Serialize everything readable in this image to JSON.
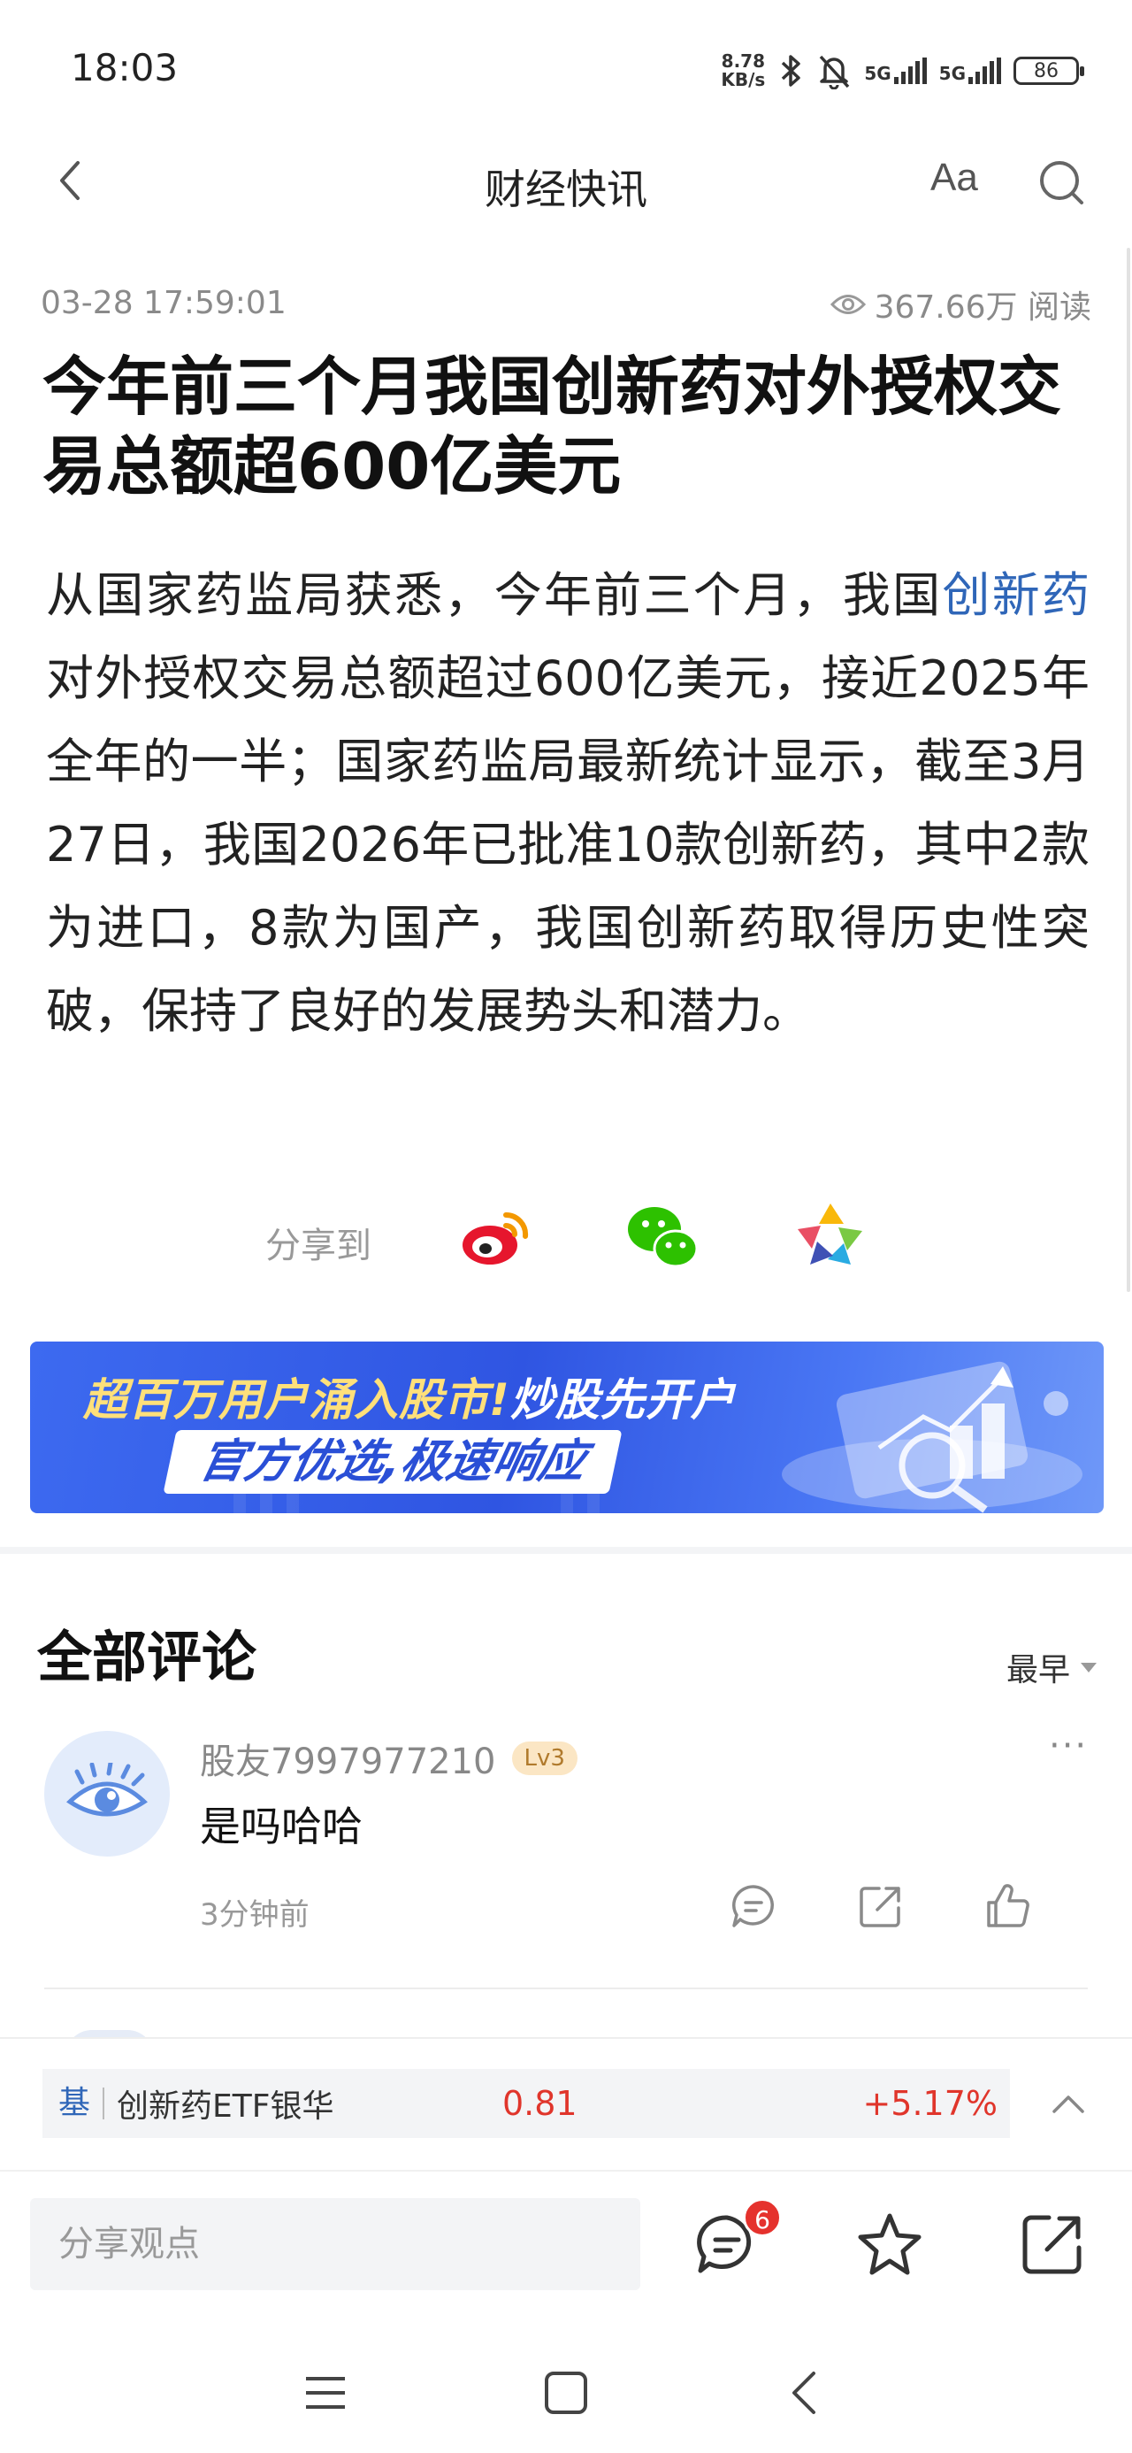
{
  "status_bar": {
    "time": "18:03",
    "net_speed_value": "8.78",
    "net_speed_unit": "KB/s",
    "signal1": "5G",
    "signal2": "5G",
    "battery": "86"
  },
  "nav": {
    "title": "财经快讯",
    "font_button": "Aa"
  },
  "article": {
    "timestamp": "03-28 17:59:01",
    "reads": "367.66万 阅读",
    "title": "今年前三个月我国创新药对外授权交易总额超600亿美元",
    "body_before_link": "从国家药监局获悉，今年前三个月，我国",
    "body_link": "创新药",
    "body_after_link": "对外授权交易总额超过600亿美元，接近2025年全年的一半；国家药监局最新统计显示，截至3月27日，我国2026年已批准10款创新药，其中2款为进口，8款为国产，我国创新药取得历史性突破，保持了良好的发展势头和潜力。"
  },
  "share": {
    "label": "分享到",
    "targets": [
      "weibo-icon",
      "wechat-icon",
      "moments-icon"
    ]
  },
  "banner": {
    "line1_a": "超百万用户涌入股市!",
    "line1_b": "炒股先开户",
    "line2": "官方优选,极速响应"
  },
  "comments": {
    "title": "全部评论",
    "sort": "最早",
    "items": [
      {
        "user": "股友7997977210",
        "level": "Lv3",
        "text": "是吗哈哈",
        "time": "3分钟前",
        "more": "···"
      }
    ]
  },
  "stock": {
    "tag": "基",
    "name": "创新药ETF银华",
    "price": "0.81",
    "change": "+5.17%"
  },
  "bottom": {
    "input_placeholder": "分享观点",
    "comment_count": "6"
  },
  "colors": {
    "link": "#2f66b8",
    "up": "#e0352b",
    "badge": "#e5322d",
    "banner_blue": "#3d6af0"
  }
}
